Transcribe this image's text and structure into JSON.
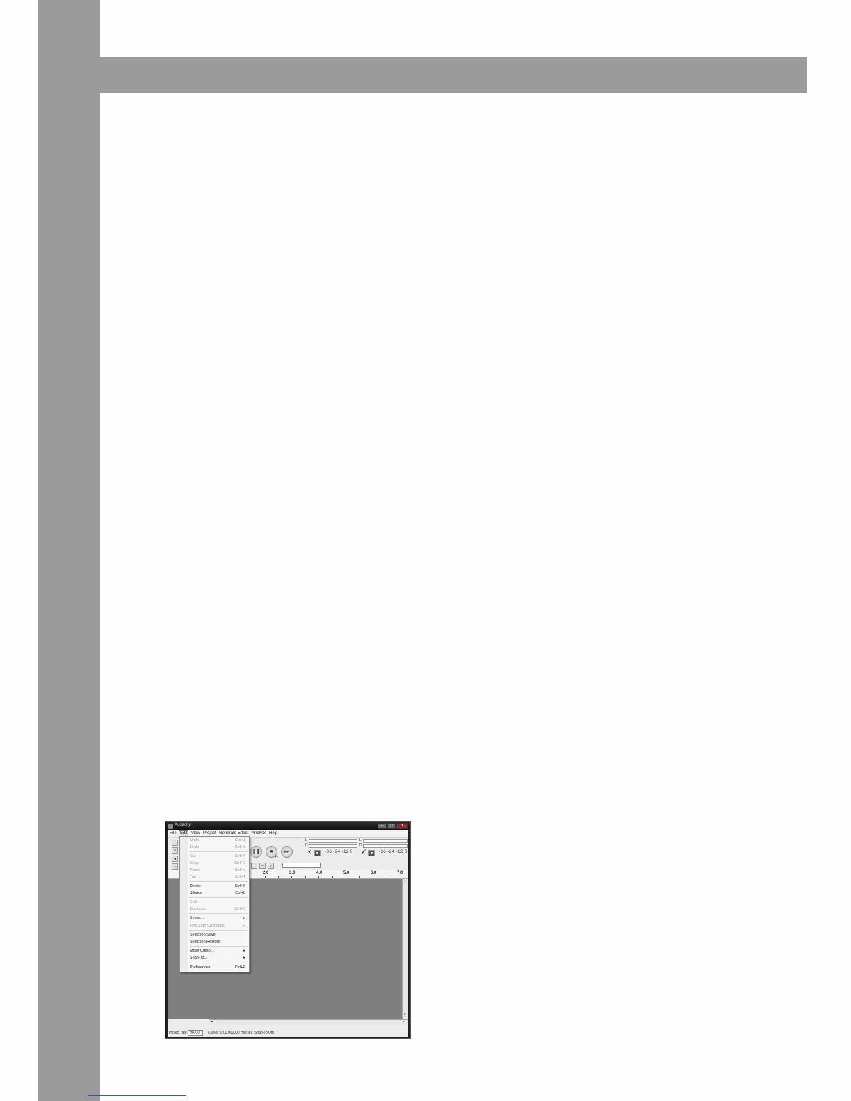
{
  "window": {
    "title": "Audacity",
    "minimize": "–",
    "maximize": "□",
    "close": "x"
  },
  "menubar": [
    "File",
    "Edit",
    "View",
    "Project",
    "Generate",
    "Effect",
    "Analyze",
    "Help"
  ],
  "toolbar": {
    "meter_out": {
      "left": "L",
      "right": "R"
    },
    "meter_in": {
      "left": "L",
      "right": "R"
    },
    "db_out": "-36  -24  -12  0",
    "db_in": "-36  -24  -12  0"
  },
  "ruler": [
    "2.0",
    "3.0",
    "4.0",
    "5.0",
    "6.0",
    "7.0"
  ],
  "edit_menu": [
    {
      "label": "Undo",
      "shortcut": "Ctrl+Z",
      "disabled": true
    },
    {
      "label": "Redo",
      "shortcut": "Ctrl+Y",
      "disabled": true
    },
    {
      "label": "Cut",
      "shortcut": "Ctrl+X",
      "disabled": true
    },
    {
      "label": "Copy",
      "shortcut": "Ctrl+C",
      "disabled": true
    },
    {
      "label": "Paste",
      "shortcut": "Ctrl+V",
      "disabled": true
    },
    {
      "label": "Trim",
      "shortcut": "Ctrl+T",
      "disabled": true
    },
    {
      "label": "Delete",
      "shortcut": "Ctrl+K",
      "disabled": false
    },
    {
      "label": "Silence",
      "shortcut": "Ctrl+L",
      "disabled": false
    },
    {
      "label": "Split",
      "shortcut": "",
      "disabled": true
    },
    {
      "label": "Duplicate",
      "shortcut": "Ctrl+D",
      "disabled": true
    },
    {
      "label": "Select...",
      "shortcut": "▸",
      "disabled": false
    },
    {
      "label": "Find Zero Crossings",
      "shortcut": "Z",
      "disabled": true
    },
    {
      "label": "Selection Save",
      "shortcut": "",
      "disabled": false
    },
    {
      "label": "Selection Restore",
      "shortcut": "",
      "disabled": false
    },
    {
      "label": "Move Cursor...",
      "shortcut": "▸",
      "disabled": false
    },
    {
      "label": "Snap-To...",
      "shortcut": "▸",
      "disabled": false
    },
    {
      "label": "Preferences...",
      "shortcut": "Ctrl+P",
      "disabled": false
    }
  ],
  "statusbar": {
    "rate_label": "Project rate:",
    "rate_value": "96000",
    "cursor": "Cursor: 0:00.000000 min:sec   [Snap-To Off]"
  }
}
